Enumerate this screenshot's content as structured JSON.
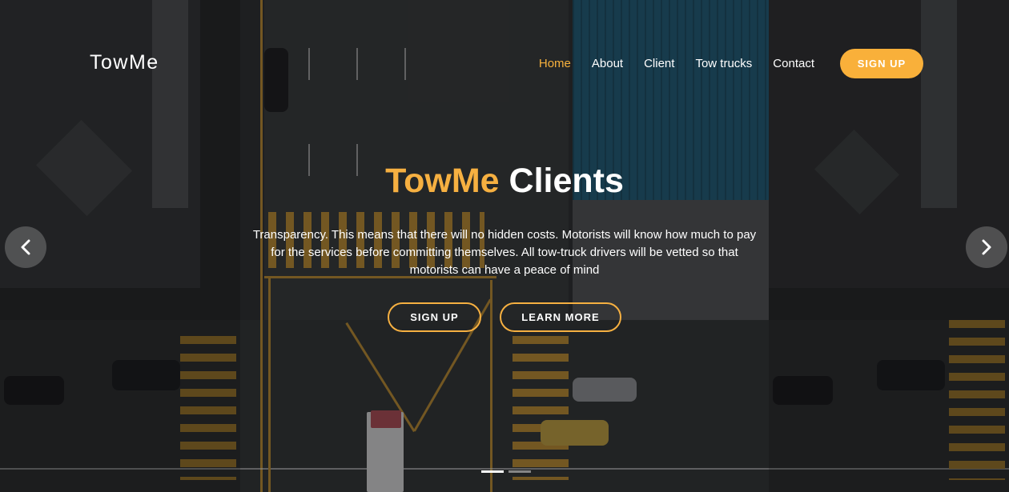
{
  "brand": {
    "name": "TowMe"
  },
  "nav": {
    "items": [
      {
        "label": "Home",
        "active": true
      },
      {
        "label": "About",
        "active": false
      },
      {
        "label": "Client",
        "active": false
      },
      {
        "label": "Tow trucks",
        "active": false
      },
      {
        "label": "Contact",
        "active": false
      }
    ],
    "signup_label": "SIGN UP"
  },
  "hero": {
    "title_accent": "TowMe",
    "title_rest": "Clients",
    "description": "Transparency. This means that there will no hidden costs. Motorists will know how much to pay for the services before committing themselves. All tow-truck drivers will be vetted so that motorists can have a peace of mind",
    "cta_primary": "SIGN UP",
    "cta_secondary": "LEARN MORE"
  },
  "carousel": {
    "prev_icon": "chevron-left-icon",
    "next_icon": "chevron-right-icon",
    "slide_count": 2,
    "active_slide": 1
  },
  "colors": {
    "accent": "#f6b041",
    "text": "#ffffff"
  }
}
